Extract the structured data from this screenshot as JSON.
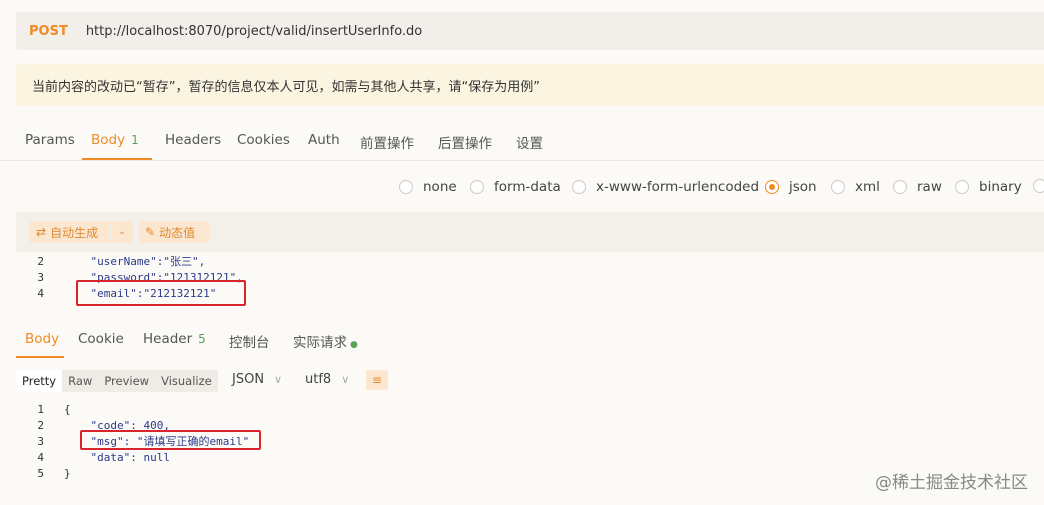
{
  "request": {
    "method": "POST",
    "url": "http://localhost:8070/project/valid/insertUserInfo.do"
  },
  "notice": "当前内容的改动已“暂存”，暂存的信息仅本人可见，如需与其他人共享，请“保存为用例”",
  "request_tabs": [
    {
      "label": "Params"
    },
    {
      "label": "Body",
      "badge": "1"
    },
    {
      "label": "Headers"
    },
    {
      "label": "Cookies"
    },
    {
      "label": "Auth"
    },
    {
      "label": "前置操作"
    },
    {
      "label": "后置操作"
    },
    {
      "label": "设置"
    }
  ],
  "body_types": [
    {
      "label": "none"
    },
    {
      "label": "form-data"
    },
    {
      "label": "x-www-form-urlencoded"
    },
    {
      "label": "json",
      "selected": true
    },
    {
      "label": "xml"
    },
    {
      "label": "raw"
    },
    {
      "label": "binary"
    }
  ],
  "toolbar": {
    "auto_generate": "自动生成",
    "dynamic_value": "动态值"
  },
  "request_code": [
    {
      "num": "2",
      "text": "    \"userName\":\"张三\","
    },
    {
      "num": "3",
      "text": "    \"password\":\"121312121\","
    },
    {
      "num": "4",
      "text": "    \"email\":\"212132121\""
    }
  ],
  "response_tabs": [
    {
      "label": "Body"
    },
    {
      "label": "Cookie"
    },
    {
      "label": "Header",
      "badge": "5"
    },
    {
      "label": "控制台"
    },
    {
      "label": "实际请求"
    }
  ],
  "format_tabs": [
    "Pretty",
    "Raw",
    "Preview",
    "Visualize"
  ],
  "format_select": "JSON",
  "encoding_select": "utf8",
  "response_code": [
    {
      "num": "1",
      "text": "{"
    },
    {
      "num": "2",
      "text": "    \"code\": 400,"
    },
    {
      "num": "3",
      "text": "    \"msg\": \"请填写正确的email\""
    },
    {
      "num": "4",
      "text": "    \"data\": null"
    },
    {
      "num": "5",
      "text": "}"
    }
  ],
  "watermark": "@稀土掘金技术社区",
  "colors": {
    "accent": "#f08a24",
    "highlight_box": "#d9232d"
  }
}
